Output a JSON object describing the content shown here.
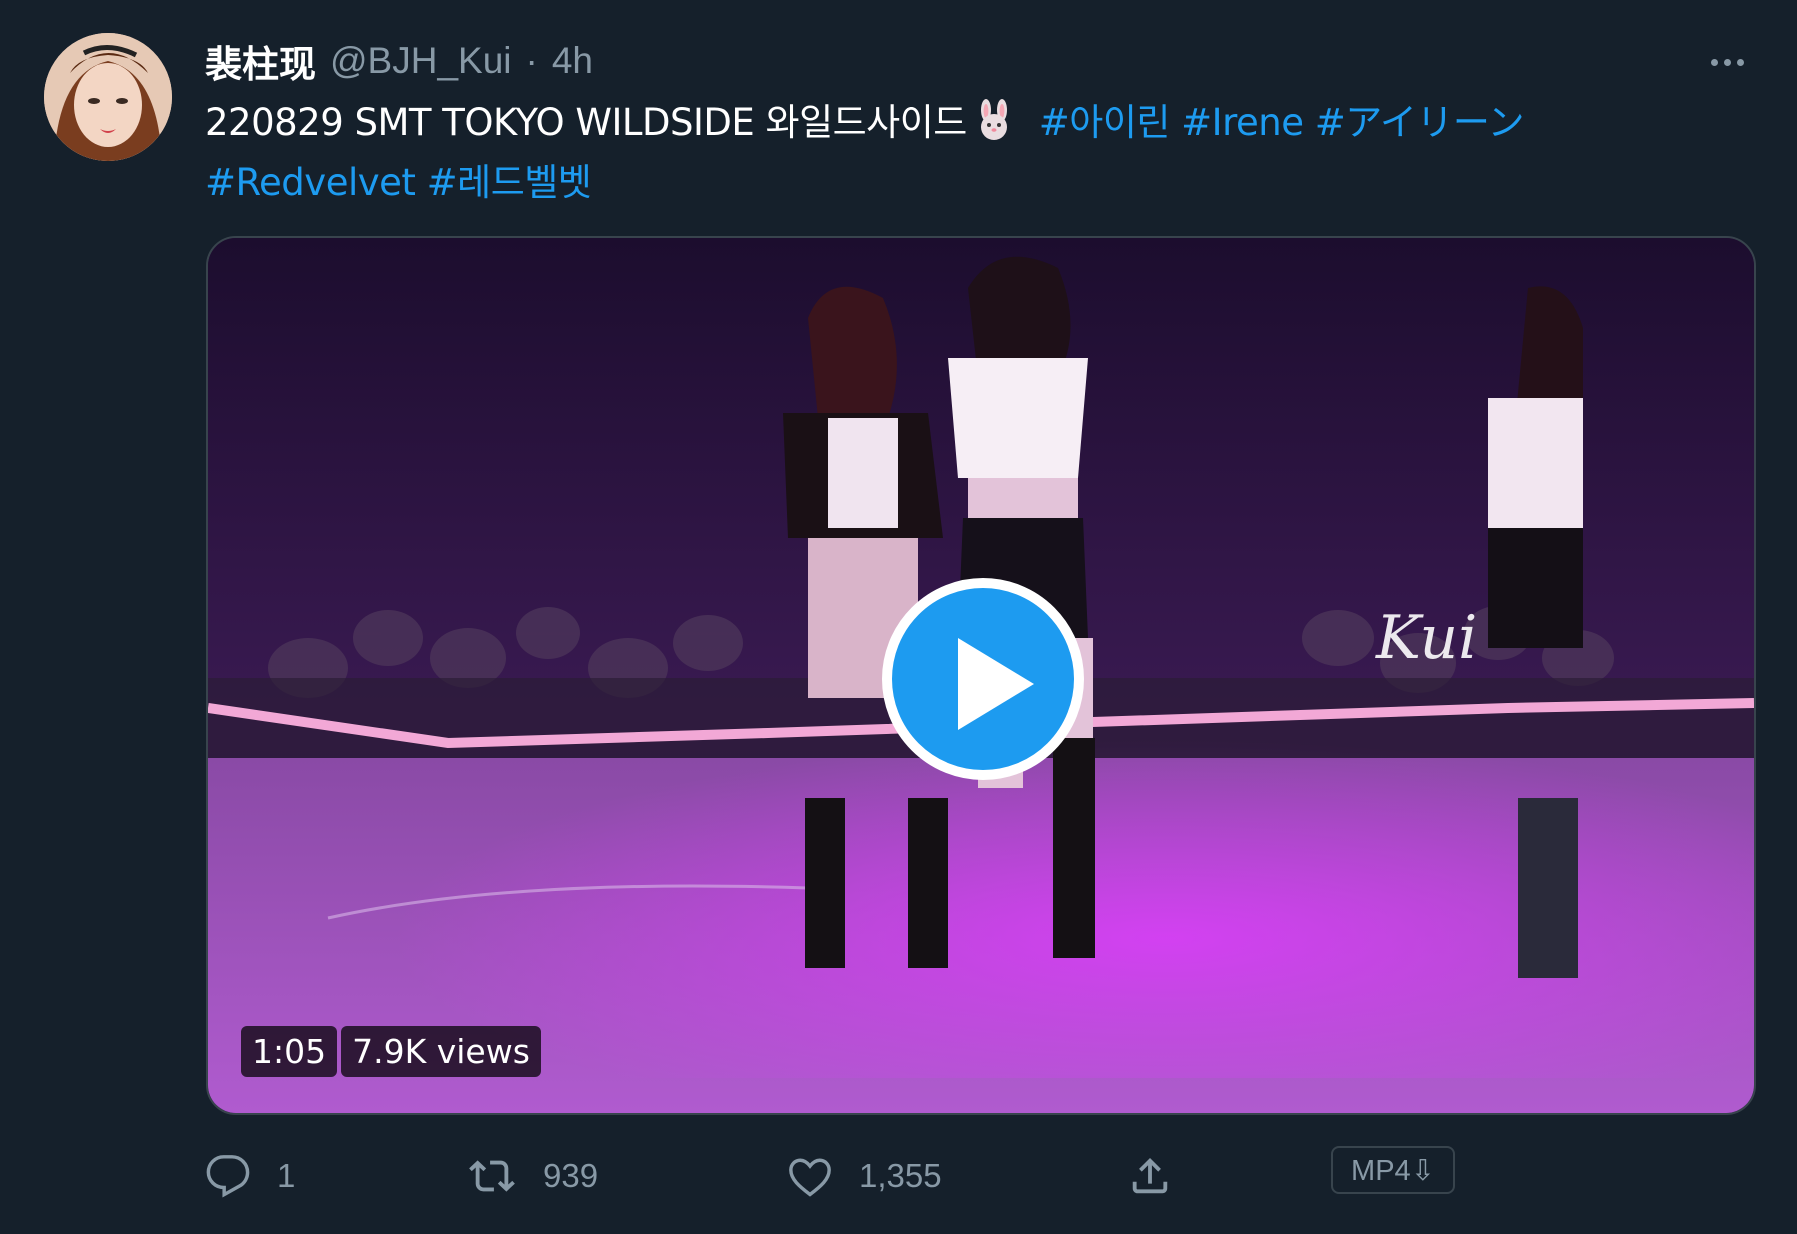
{
  "tweet": {
    "display_name": "裴柱现",
    "handle": "@BJH_Kui",
    "separator": "·",
    "time": "4h",
    "text_main": "220829 SMT TOKYO  WILDSIDE 와일드사이드",
    "emoji": "rabbit-face",
    "hashtags": [
      "#아이린",
      "#Irene",
      "#アイリーン",
      "#Redvelvet",
      "#레드벨벳"
    ]
  },
  "video": {
    "duration": "1:05",
    "views": "7.9K views",
    "watermark": "Kui"
  },
  "actions": {
    "reply_count": "1",
    "retweet_count": "939",
    "like_count": "1,355",
    "mp4_label": "MP4⇩"
  },
  "colors": {
    "background": "#15202b",
    "accent": "#1d9bf0",
    "muted": "#8899a6",
    "border": "#38444d"
  }
}
